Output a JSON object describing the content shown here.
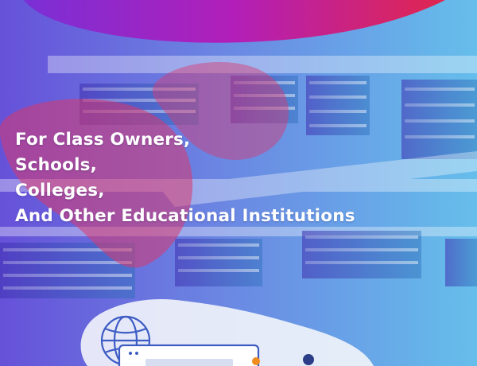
{
  "headline": {
    "line1": "For Class Owners,",
    "line2": "Schools,",
    "line3": "Colleges,",
    "line4": "And Other Educational Institutions"
  },
  "colors": {
    "gradient_left": "#5a43d6",
    "gradient_right": "#59b9ea",
    "accent_blob": "#d9386e",
    "top_blob": "#b21fb8",
    "text": "#ffffff"
  },
  "icons": [
    "globe-icon",
    "laptop-icon"
  ]
}
